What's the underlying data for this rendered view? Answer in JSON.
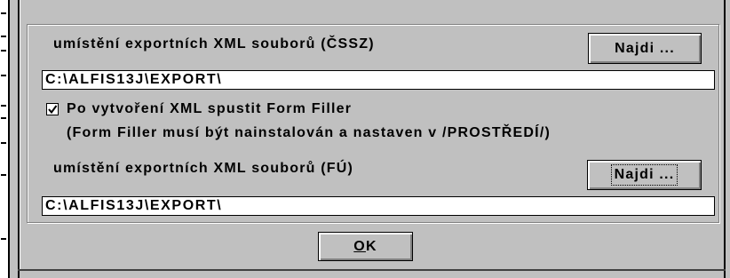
{
  "colors": {
    "face": "#c0c0c0",
    "field": "#ffffff",
    "text": "#000000",
    "shadow": "#808080",
    "highlight": "#ffffff"
  },
  "dialog": {
    "cssz": {
      "label": "umístění exportních XML souborů (ČSSZ)",
      "browse_label": "Najdi ...",
      "path_value": "C:\\ALFIS13J\\EXPORT\\"
    },
    "form_filler": {
      "checked": true,
      "label": "Po vytvoření XML spustit Form Filler",
      "note": "(Form Filler musí být nainstalován a nastaven v /PROSTŘEDÍ/)"
    },
    "fu": {
      "label": "umístění exportních XML souborů (FÚ)",
      "browse_label": "Najdi ...",
      "browse_focused": true,
      "path_value": "C:\\ALFIS13J\\EXPORT\\"
    },
    "ok_label": "OK"
  }
}
